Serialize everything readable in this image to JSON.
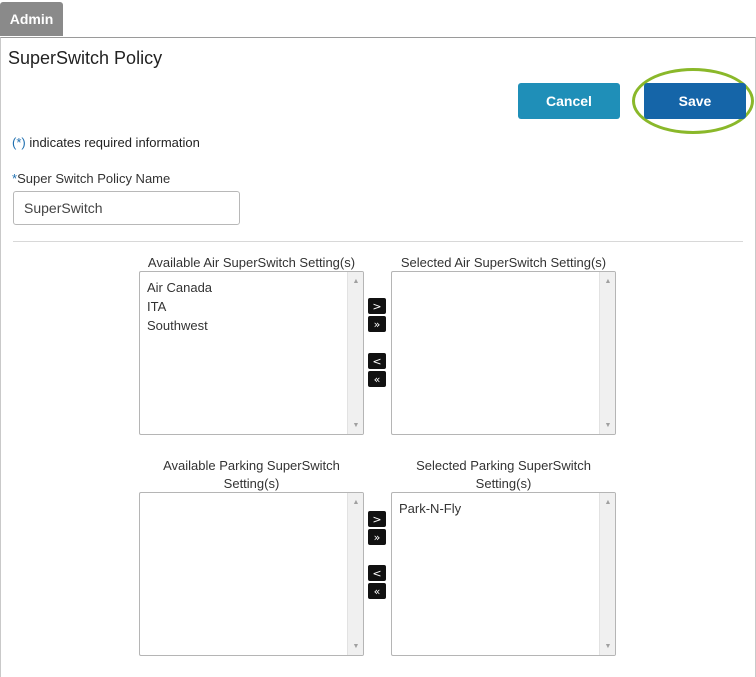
{
  "tab": {
    "label": "Admin"
  },
  "page": {
    "title": "SuperSwitch Policy"
  },
  "actions": {
    "cancel_label": "Cancel",
    "save_label": "Save"
  },
  "required_note": {
    "star": "(*)",
    "text": " indicates required information"
  },
  "policy_name": {
    "star": "*",
    "label": "Super Switch Policy Name",
    "value": "SuperSwitch"
  },
  "air": {
    "available_label": "Available Air SuperSwitch Setting(s)",
    "selected_label": "Selected Air SuperSwitch Setting(s)",
    "available_items": [
      "Air Canada",
      "ITA",
      "Southwest"
    ],
    "selected_items": []
  },
  "parking": {
    "available_label": "Available Parking SuperSwitch Setting(s)",
    "selected_label": "Selected Parking SuperSwitch Setting(s)",
    "available_items": [],
    "selected_items": [
      "Park-N-Fly"
    ]
  },
  "move_buttons": {
    "move_right": ">",
    "move_all_right": "»",
    "move_left": "<",
    "move_all_left": "«"
  },
  "icons": {
    "scroll_up": "▲",
    "scroll_down": "▼"
  },
  "colors": {
    "cancel": "#1f8fb8",
    "save": "#1565a8",
    "highlight_ring": "#8ab82a",
    "tab": "#8a8a8a"
  }
}
